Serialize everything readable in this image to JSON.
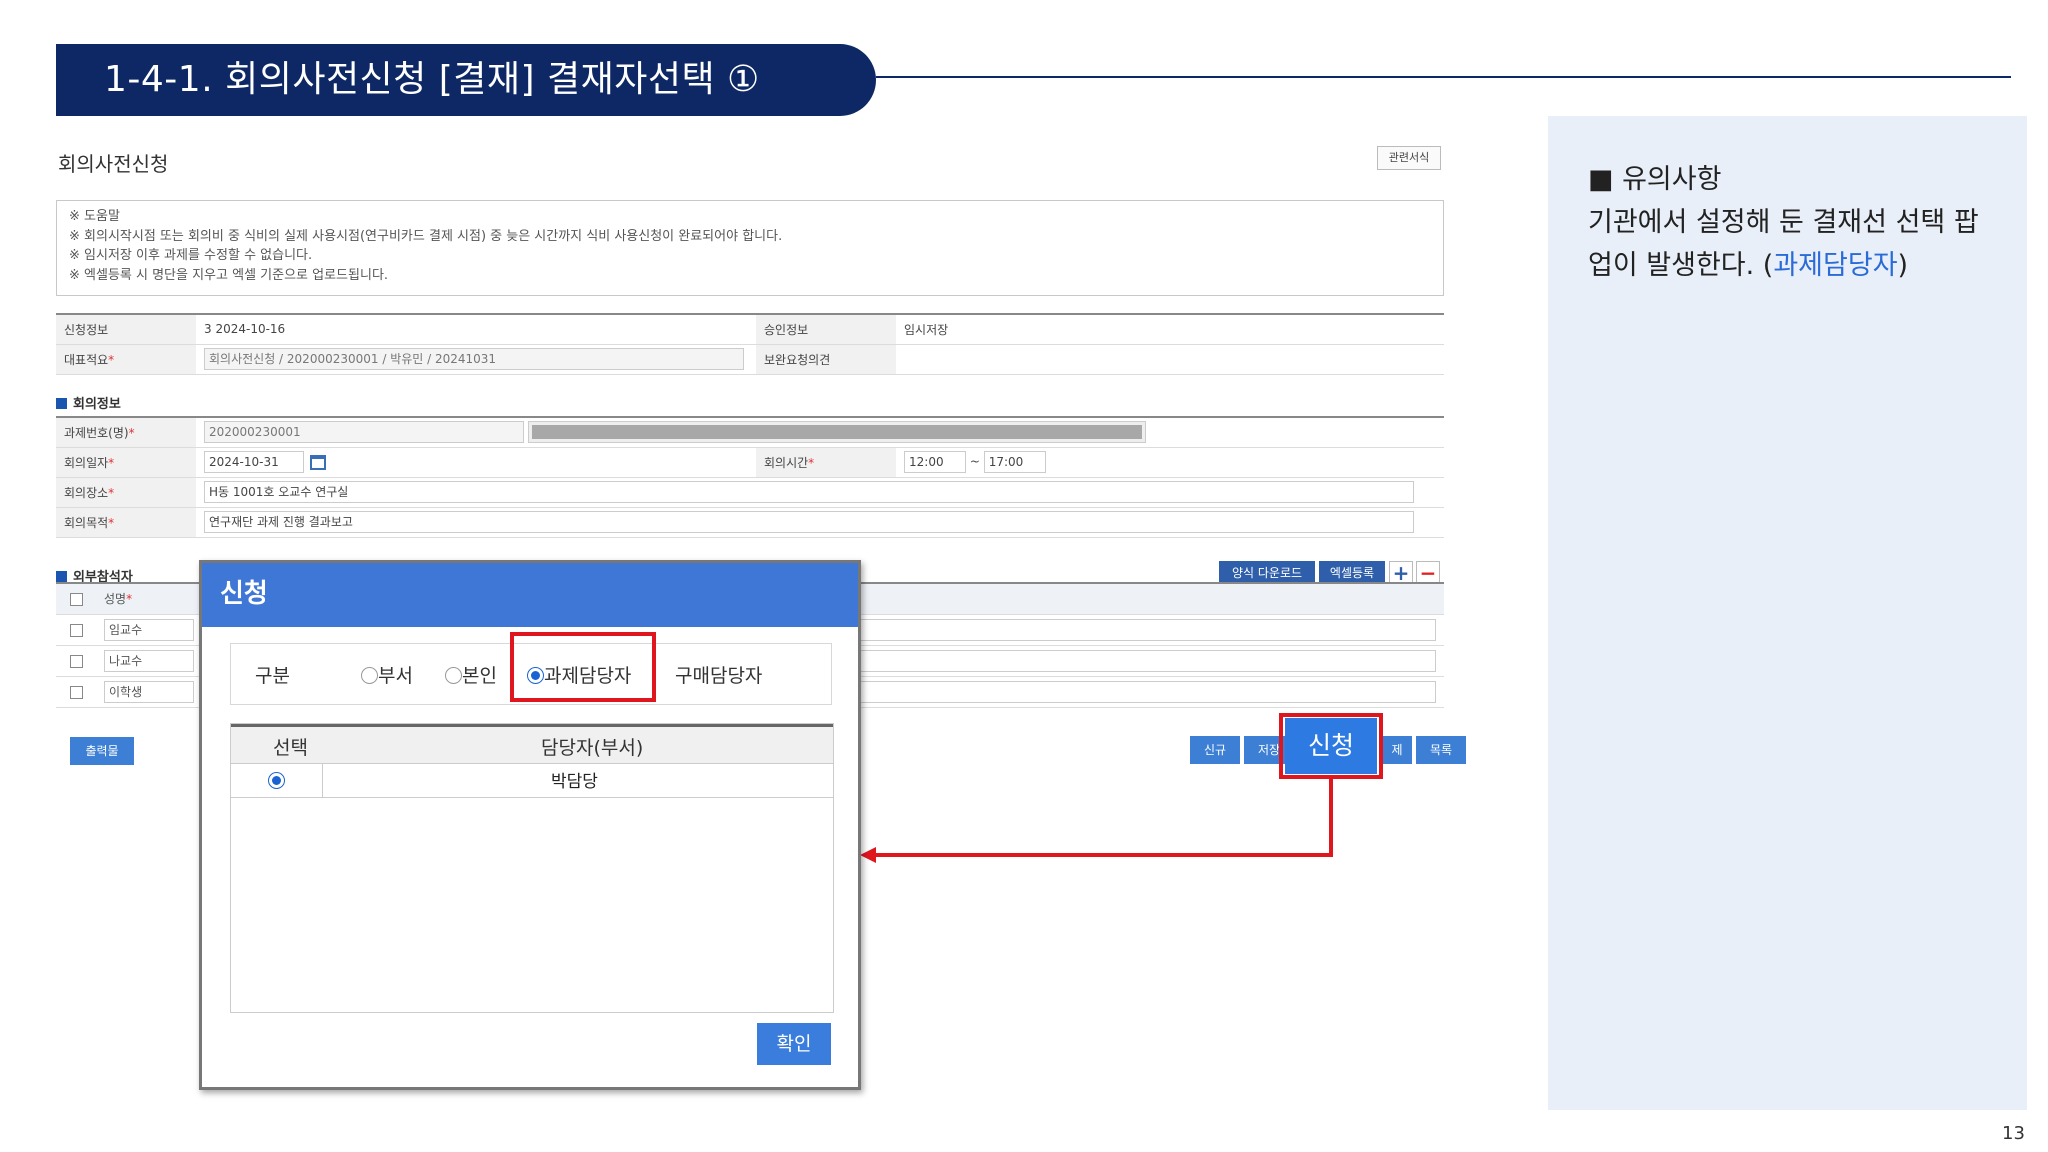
{
  "slide": {
    "title": "1-4-1. 회의사전신청 [결재] 결재자선택 ①",
    "page_number": "13"
  },
  "app": {
    "title": "회의사전신청",
    "related_btn": "관련서식",
    "help_lines": [
      "※ 도움말",
      "※ 회의시작시점 또는 회의비 중 식비의 실제 사용시점(연구비카드 결제 시점) 중 늦은 시간까지 식비 사용신청이 완료되어야 합니다.",
      "※ 임시저장 이후 과제를 수정할 수 없습니다.",
      "※ 엑셀등록 시 명단을 지우고 엑셀 기준으로 업로드됩니다."
    ],
    "info": {
      "apply_info_label": "신청정보",
      "apply_info_value": "3 2024-10-16",
      "approval_info_label": "승인정보",
      "approval_info_value": "임시저장",
      "summary_label": "대표적요",
      "summary_value": "회의사전신청 / 202000230001 / 박유민 / 20241031",
      "supplement_label": "보완요청의견"
    },
    "meeting": {
      "section_title": "회의정보",
      "project_label": "과제번호(명)",
      "project_value": "202000230001",
      "date_label": "회의일자",
      "date_value": "2024-10-31",
      "time_label": "회의시간",
      "time_start": "12:00",
      "time_sep": "~",
      "time_end": "17:00",
      "place_label": "회의장소",
      "place_value": "H동 1001호 오교수 연구실",
      "purpose_label": "회의목적",
      "purpose_value": "연구재단 과제 진행 결과보고"
    },
    "external": {
      "section_title": "외부참석자",
      "download_btn": "양식 다운로드",
      "excel_btn": "엑셀등록",
      "add_symbol": "+",
      "remove_symbol": "−",
      "name_header": "성명",
      "names": [
        "임교수",
        "나교수",
        "이학생"
      ]
    },
    "print_btn": "출력물",
    "actions": {
      "new": "신규",
      "save": "저장",
      "apply": "신청",
      "delete": "제",
      "list": "목록"
    }
  },
  "modal": {
    "title": "신청",
    "type_label": "구분",
    "options": [
      "부서",
      "본인",
      "과제담당자",
      "구매담당자"
    ],
    "selected_option": "과제담당자",
    "grid_headers": [
      "선택",
      "담당자(부서)"
    ],
    "rows": [
      {
        "selected": true,
        "name": "박담당"
      }
    ],
    "confirm_btn": "확인"
  },
  "note": {
    "heading": "■ 유의사항",
    "body_prefix": "기관에서 설정해 둔 결재선 선택 팝업이 발생한다. (",
    "body_accent": "과제담당자",
    "body_suffix": ")"
  },
  "colors": {
    "banner": "#0d2864",
    "modal_header": "#3e77d6",
    "highlight": "#e0161e",
    "note_bg": "#e9eff8",
    "accent_text": "#2a6bd8"
  }
}
